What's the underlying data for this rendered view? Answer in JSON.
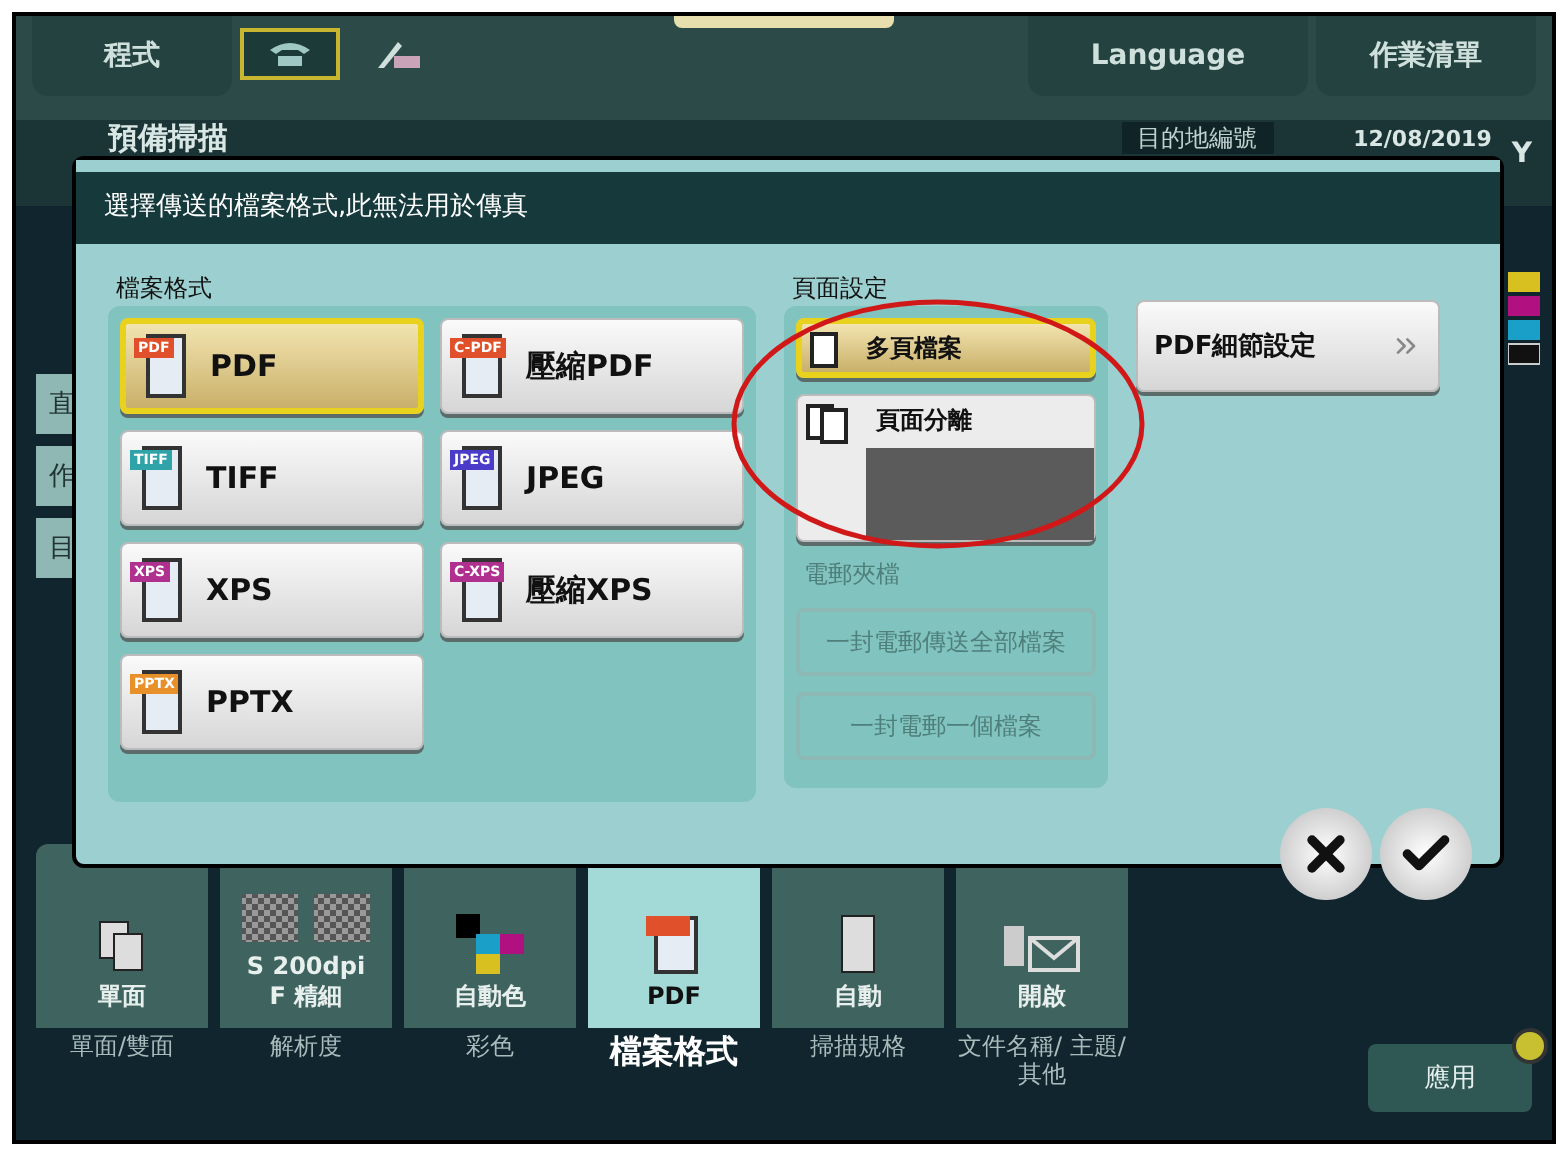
{
  "top_bar": {
    "left_buttons": [
      {
        "kind": "text",
        "label": "程式",
        "selected": false
      },
      {
        "kind": "phone",
        "selected": true
      },
      {
        "kind": "pen",
        "selected": false
      }
    ],
    "right_buttons": [
      "Language",
      "作業清單"
    ]
  },
  "header": {
    "title": "預備掃描",
    "destination_label": "目的地編號",
    "date": "12/08/2019",
    "toner_label": "Y"
  },
  "side_tabs": [
    "直",
    "作",
    "目"
  ],
  "dialog": {
    "message": "選擇傳送的檔案格式,此無法用於傳真",
    "file_format": {
      "label": "檔案格式",
      "options": [
        {
          "label": "PDF",
          "badge": "PDF",
          "color": "#e0502a",
          "selected": true
        },
        {
          "label": "壓縮PDF",
          "badge": "C-PDF",
          "color": "#e0502a",
          "selected": false
        },
        {
          "label": "TIFF",
          "badge": "TIFF",
          "color": "#2fa3a8",
          "selected": false
        },
        {
          "label": "JPEG",
          "badge": "JPEG",
          "color": "#4a3cc8",
          "selected": false
        },
        {
          "label": "XPS",
          "badge": "XPS",
          "color": "#b0308f",
          "selected": false
        },
        {
          "label": "壓縮XPS",
          "badge": "C-XPS",
          "color": "#b0308f",
          "selected": false
        },
        {
          "label": "PPTX",
          "badge": "PPTX",
          "color": "#e8902a",
          "selected": false
        }
      ]
    },
    "page_setting": {
      "label": "頁面設定",
      "options": [
        {
          "label": "多頁檔案",
          "selected": true
        },
        {
          "label": "頁面分離",
          "selected": false
        }
      ]
    },
    "email_attach": {
      "label": "電郵夾檔",
      "disabled": true,
      "options": [
        "一封電郵傳送全部檔案",
        "一封電郵一個檔案"
      ]
    },
    "detail_button": "PDF細節設定"
  },
  "function_tiles": [
    {
      "kind": "duplex",
      "value": [
        "單面"
      ],
      "caption": "單面/雙面",
      "selected": false
    },
    {
      "kind": "resolution",
      "value": [
        "S 200dpi",
        "F 精細"
      ],
      "caption": "解析度",
      "selected": false
    },
    {
      "kind": "color",
      "value": [
        "自動色"
      ],
      "caption": "彩色",
      "selected": false
    },
    {
      "kind": "pdf",
      "value": [
        "PDF"
      ],
      "caption": "檔案格式",
      "selected": true
    },
    {
      "kind": "size",
      "value": [
        "自動"
      ],
      "caption": "掃描規格",
      "selected": false
    },
    {
      "kind": "mail",
      "value": [
        "開啟"
      ],
      "caption": "文件名稱/ 主題/其他",
      "selected": false
    }
  ],
  "apply_button": "應用"
}
